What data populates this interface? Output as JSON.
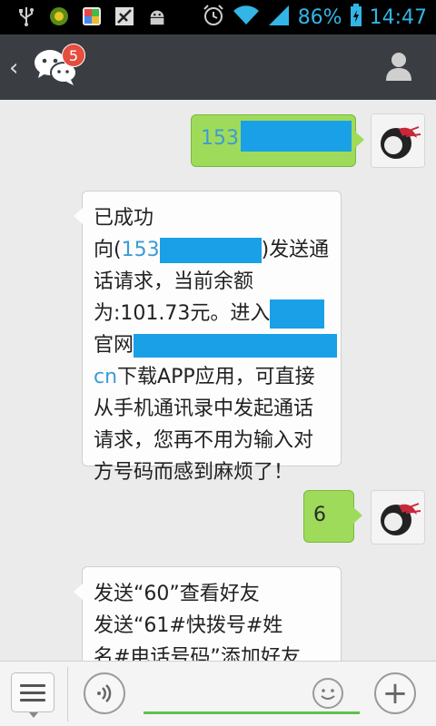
{
  "status_bar": {
    "battery_percent": "86%",
    "time": "14:47"
  },
  "header": {
    "back_symbol": "‹",
    "unread_badge": "5",
    "icons": [
      "chevron-left-icon",
      "wechat-logo-icon",
      "profile-icon"
    ]
  },
  "messages": [
    {
      "side": "out",
      "text_visible": "153",
      "redacted": true
    },
    {
      "side": "in",
      "lines": [
        {
          "parts": [
            "已成功"
          ]
        },
        {
          "parts": [
            "向(",
            "153",
            ")发送通"
          ]
        },
        {
          "parts": [
            "话请求，当前余额"
          ]
        },
        {
          "parts": [
            "为:101.73元。进入"
          ]
        },
        {
          "parts": [
            "官网"
          ]
        },
        {
          "parts": [
            "cn",
            "下载APP应用，可直接"
          ]
        },
        {
          "parts": [
            "从手机通讯录中发起通话"
          ]
        },
        {
          "parts": [
            "请求，您再不用为输入对"
          ]
        },
        {
          "parts": [
            "方号码而感到麻烦了！"
          ]
        }
      ]
    },
    {
      "side": "out",
      "text_visible": "6"
    },
    {
      "side": "in",
      "lines": [
        {
          "parts": [
            "发送“60”查看好友"
          ]
        },
        {
          "parts": [
            "发送“61#快拨号#姓"
          ]
        },
        {
          "parts": [
            "名#电话号码”添加好友"
          ]
        }
      ]
    }
  ],
  "input_bar": {
    "plus_label": "+",
    "icons": [
      "menu-icon",
      "voice-icon",
      "emoji-icon",
      "plus-icon"
    ]
  },
  "colors": {
    "header_bg": "#3a3e43",
    "outgoing_bubble": "#9fdb5a",
    "incoming_bubble": "#fdfdfd",
    "redaction_blue": "#1aa0e6",
    "link_blue": "#3b9bd6",
    "badge_red": "#e54d3e",
    "input_underline": "#5cc34a"
  }
}
